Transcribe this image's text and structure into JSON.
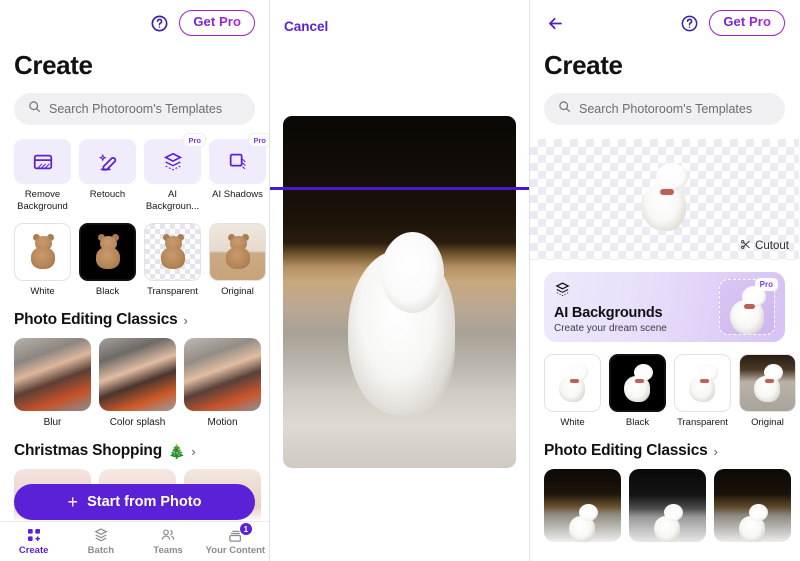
{
  "app": {
    "accent_purple": "#5b21d6",
    "accent_magenta": "#c026d3",
    "search_bg": "#f0f0f3",
    "tool_tile_bg": "#f0ecfb"
  },
  "left_panel": {
    "topbar": {
      "help_icon": "help-question-icon",
      "get_pro_label": "Get Pro"
    },
    "title": "Create",
    "search": {
      "icon": "search-icon",
      "placeholder": "Search Photoroom's Templates"
    },
    "tools": [
      {
        "label": "Remove Background",
        "icon": "remove-background-icon",
        "pro": ""
      },
      {
        "label": "Retouch",
        "icon": "retouch-eraser-icon",
        "pro": ""
      },
      {
        "label": "AI Backgroun...",
        "icon": "ai-layers-icon",
        "pro": "Pro"
      },
      {
        "label": "AI Shadows",
        "icon": "ai-shadows-icon",
        "pro": "Pro"
      }
    ],
    "variants": [
      {
        "label": "White",
        "selected": false
      },
      {
        "label": "Black",
        "selected": true
      },
      {
        "label": "Transparent",
        "selected": false
      },
      {
        "label": "Original",
        "selected": false
      }
    ],
    "classics_section": {
      "title": "Photo Editing Classics",
      "chevron": "›",
      "items": [
        {
          "label": "Blur"
        },
        {
          "label": "Color splash"
        },
        {
          "label": "Motion"
        }
      ]
    },
    "christmas_section": {
      "title": "Christmas Shopping",
      "emoji": "🎄",
      "chevron": "›"
    },
    "cta": {
      "plus": "+",
      "label": "Start from Photo"
    },
    "bottom_nav": [
      {
        "label": "Create",
        "icon": "create-grid-icon",
        "active": true,
        "badge": ""
      },
      {
        "label": "Batch",
        "icon": "batch-layers-icon",
        "active": false,
        "badge": ""
      },
      {
        "label": "Teams",
        "icon": "teams-people-icon",
        "active": false,
        "badge": ""
      },
      {
        "label": "Your Content",
        "icon": "your-content-icon",
        "active": false,
        "badge": "1"
      }
    ]
  },
  "mid_panel": {
    "cancel_label": "Cancel",
    "photo_alt": "white-puppy-photo",
    "scanline_color": "#4b18d0"
  },
  "right_panel": {
    "topbar": {
      "back_icon": "back-arrow-icon",
      "help_icon": "help-question-icon",
      "get_pro_label": "Get Pro"
    },
    "title": "Create",
    "search": {
      "icon": "search-icon",
      "placeholder": "Search Photoroom's Templates"
    },
    "cutout": {
      "icon": "scissors-icon",
      "label": "Cutout"
    },
    "ai_card": {
      "icon": "ai-layers-icon",
      "title": "AI Backgrounds",
      "subtitle": "Create your dream scene",
      "pro_badge": "Pro"
    },
    "variants": [
      {
        "label": "White",
        "selected": false
      },
      {
        "label": "Black",
        "selected": true
      },
      {
        "label": "Transparent",
        "selected": false
      },
      {
        "label": "Original",
        "selected": false
      }
    ],
    "classics_section": {
      "title": "Photo Editing Classics",
      "chevron": "›"
    }
  }
}
